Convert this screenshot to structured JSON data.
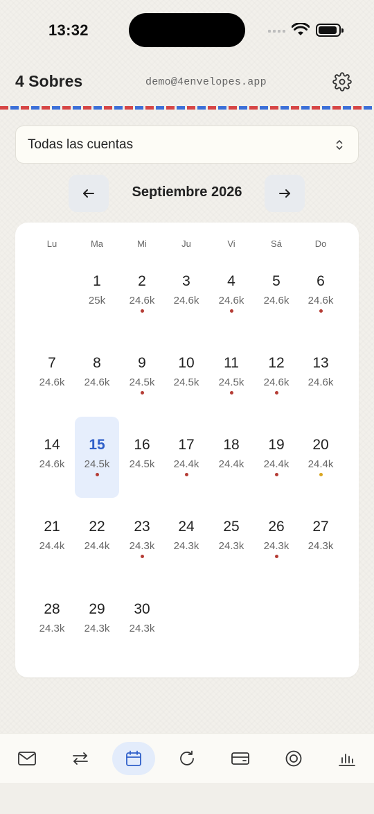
{
  "status_bar": {
    "time": "13:32"
  },
  "header": {
    "title": "4 Sobres",
    "email": "demo@4envelopes.app"
  },
  "account_selector": {
    "label": "Todas las cuentas"
  },
  "month_nav": {
    "prev": "←",
    "title": "Septiembre 2026",
    "next": "→"
  },
  "weekdays": [
    "Lu",
    "Ma",
    "Mi",
    "Ju",
    "Vi",
    "Sá",
    "Do"
  ],
  "colors": {
    "accent": "#2f5fc9",
    "dot_red": "#b53c35",
    "dot_amber": "#d9a520",
    "selected_bg": "#e6eefc"
  },
  "days": [
    {
      "day": "1",
      "amount": "25k",
      "dot": null
    },
    {
      "day": "2",
      "amount": "24.6k",
      "dot": "red"
    },
    {
      "day": "3",
      "amount": "24.6k",
      "dot": null
    },
    {
      "day": "4",
      "amount": "24.6k",
      "dot": "red"
    },
    {
      "day": "5",
      "amount": "24.6k",
      "dot": null
    },
    {
      "day": "6",
      "amount": "24.6k",
      "dot": "red"
    },
    {
      "day": "7",
      "amount": "24.6k",
      "dot": null
    },
    {
      "day": "8",
      "amount": "24.6k",
      "dot": null
    },
    {
      "day": "9",
      "amount": "24.5k",
      "dot": "red"
    },
    {
      "day": "10",
      "amount": "24.5k",
      "dot": null
    },
    {
      "day": "11",
      "amount": "24.5k",
      "dot": "red"
    },
    {
      "day": "12",
      "amount": "24.6k",
      "dot": "red"
    },
    {
      "day": "13",
      "amount": "24.6k",
      "dot": null
    },
    {
      "day": "14",
      "amount": "24.6k",
      "dot": null
    },
    {
      "day": "15",
      "amount": "24.5k",
      "dot": "red",
      "selected": true
    },
    {
      "day": "16",
      "amount": "24.5k",
      "dot": null
    },
    {
      "day": "17",
      "amount": "24.4k",
      "dot": "red"
    },
    {
      "day": "18",
      "amount": "24.4k",
      "dot": null
    },
    {
      "day": "19",
      "amount": "24.4k",
      "dot": "red"
    },
    {
      "day": "20",
      "amount": "24.4k",
      "dot": "amber"
    },
    {
      "day": "21",
      "amount": "24.4k",
      "dot": null
    },
    {
      "day": "22",
      "amount": "24.4k",
      "dot": null
    },
    {
      "day": "23",
      "amount": "24.3k",
      "dot": "red"
    },
    {
      "day": "24",
      "amount": "24.3k",
      "dot": null
    },
    {
      "day": "25",
      "amount": "24.3k",
      "dot": null
    },
    {
      "day": "26",
      "amount": "24.3k",
      "dot": "red"
    },
    {
      "day": "27",
      "amount": "24.3k",
      "dot": null
    },
    {
      "day": "28",
      "amount": "24.3k",
      "dot": null
    },
    {
      "day": "29",
      "amount": "24.3k",
      "dot": null
    },
    {
      "day": "30",
      "amount": "24.3k",
      "dot": null
    }
  ],
  "bottom_nav": [
    {
      "icon": "envelope-icon",
      "active": false
    },
    {
      "icon": "transfer-icon",
      "active": false
    },
    {
      "icon": "calendar-icon",
      "active": true
    },
    {
      "icon": "refresh-icon",
      "active": false
    },
    {
      "icon": "card-icon",
      "active": false
    },
    {
      "icon": "target-icon",
      "active": false
    },
    {
      "icon": "bar-chart-icon",
      "active": false
    }
  ]
}
